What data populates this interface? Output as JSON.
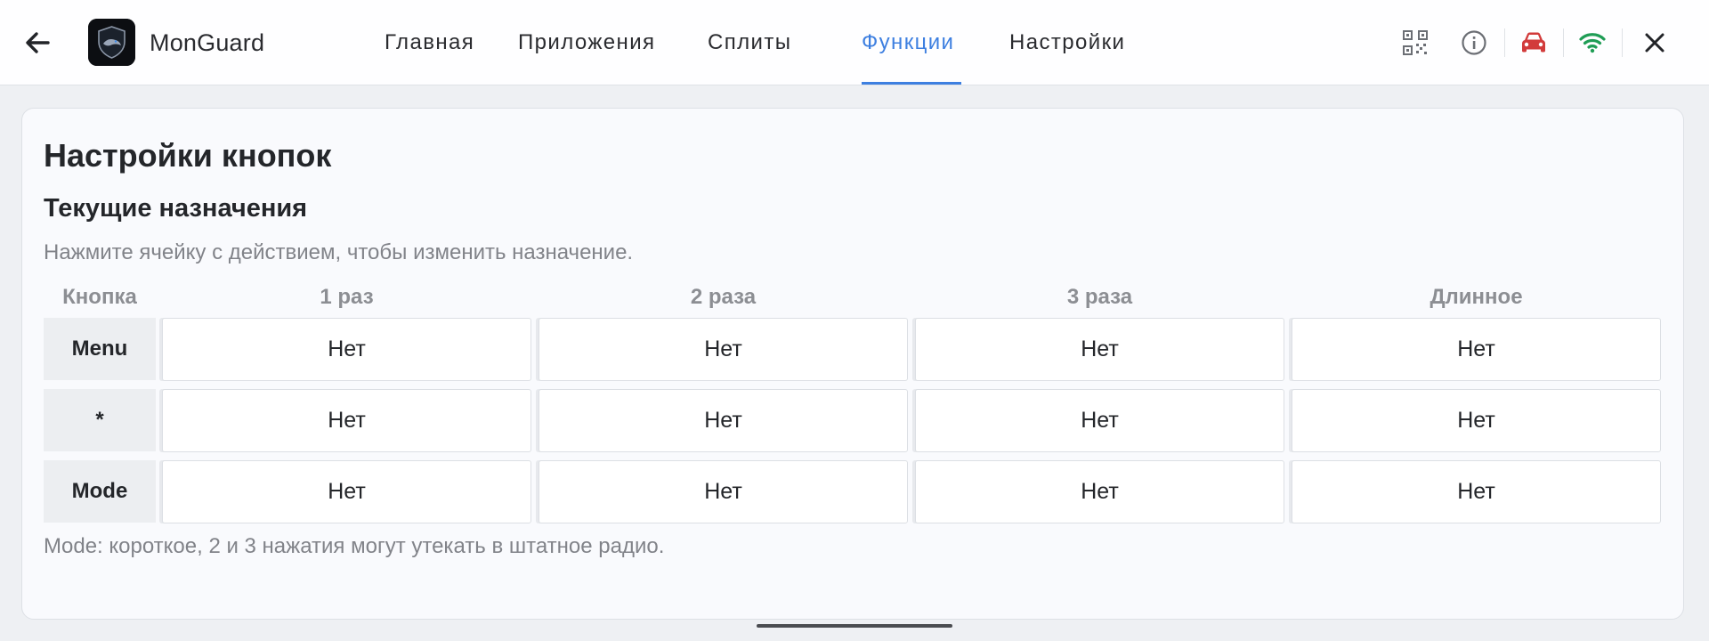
{
  "app": {
    "name": "MonGuard"
  },
  "nav": {
    "tabs": [
      {
        "label": "Главная"
      },
      {
        "label": "Приложения"
      },
      {
        "label": "Сплиты"
      },
      {
        "label": "Функции",
        "active": true
      },
      {
        "label": "Настройки"
      }
    ]
  },
  "status_icons": [
    "qr-code-icon",
    "info-icon",
    "car-icon",
    "wifi-icon",
    "close-icon"
  ],
  "colors": {
    "accent": "#3d7fe0",
    "car_icon": "#d23b3b",
    "wifi_icon": "#1f9d55"
  },
  "page": {
    "title": "Настройки кнопок",
    "section_title": "Текущие назначения",
    "hint": "Нажмите ячейку с действием, чтобы изменить назначение.",
    "footnote": "Mode: короткое, 2 и 3 нажатия могут утекать в штатное радио."
  },
  "table": {
    "headers": [
      "Кнопка",
      "1 раз",
      "2 раза",
      "3 раза",
      "Длинное"
    ],
    "rows": [
      {
        "button": "Menu",
        "cells": [
          "Нет",
          "Нет",
          "Нет",
          "Нет"
        ]
      },
      {
        "button": "*",
        "cells": [
          "Нет",
          "Нет",
          "Нет",
          "Нет"
        ]
      },
      {
        "button": "Mode",
        "cells": [
          "Нет",
          "Нет",
          "Нет",
          "Нет"
        ]
      }
    ]
  }
}
